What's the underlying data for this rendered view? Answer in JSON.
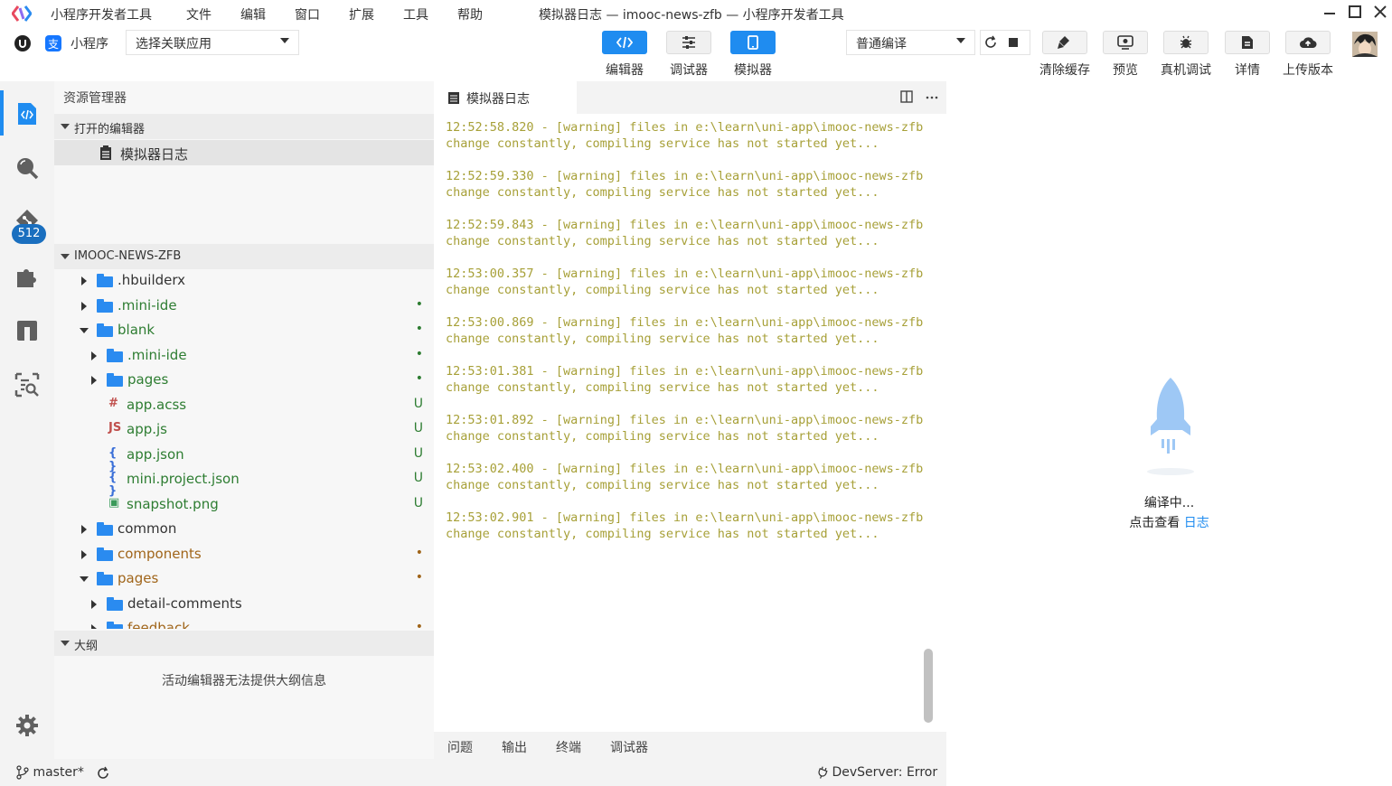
{
  "app": {
    "menu": [
      "小程序开发者工具",
      "文件",
      "编辑",
      "窗口",
      "扩展",
      "工具",
      "帮助"
    ],
    "window_title": "模拟器日志 — imooc-news-zfb — 小程序开发者工具"
  },
  "toolbar": {
    "mode_label": "小程序",
    "app_select": "选择关联应用",
    "view_buttons": [
      {
        "label": "编辑器",
        "icon": "code-icon",
        "active": true
      },
      {
        "label": "调试器",
        "icon": "sliders-icon",
        "active": false
      },
      {
        "label": "模拟器",
        "icon": "phone-icon",
        "active": true
      }
    ],
    "compile_select": "普通编译",
    "actions": [
      {
        "label": "清除缓存",
        "icon": "brush-icon"
      },
      {
        "label": "预览",
        "icon": "eye-icon"
      },
      {
        "label": "真机调试",
        "icon": "bug-icon"
      },
      {
        "label": "详情",
        "icon": "document-icon"
      },
      {
        "label": "上传版本",
        "icon": "cloud-upload-icon"
      }
    ]
  },
  "activity_bar": {
    "items": [
      "code-icon",
      "search-icon",
      "source-control-icon",
      "extensions-icon",
      "layout-icon",
      "inspect-icon"
    ],
    "badge": "512",
    "settings_icon": "gear-icon"
  },
  "sidebar": {
    "title": "资源管理器",
    "open_editors_header": "打开的编辑器",
    "open_editors": [
      "模拟器日志"
    ],
    "project_header": "IMOOC-NEWS-ZFB",
    "tree": [
      {
        "name": ".hbuilderx",
        "type": "folder",
        "depth": 0,
        "expanded": false,
        "status": "",
        "color": "#333333"
      },
      {
        "name": ".mini-ide",
        "type": "folder",
        "depth": 0,
        "expanded": false,
        "status": "•",
        "color": "#2e7d32"
      },
      {
        "name": "blank",
        "type": "folder",
        "depth": 0,
        "expanded": true,
        "status": "•",
        "color": "#2e7d32"
      },
      {
        "name": ".mini-ide",
        "type": "folder",
        "depth": 1,
        "expanded": false,
        "status": "•",
        "color": "#2e7d32"
      },
      {
        "name": "pages",
        "type": "folder",
        "depth": 1,
        "expanded": false,
        "status": "•",
        "color": "#2e7d32"
      },
      {
        "name": "app.acss",
        "type": "css",
        "depth": 1,
        "status": "U",
        "color": "#2e7d32"
      },
      {
        "name": "app.js",
        "type": "js",
        "depth": 1,
        "status": "U",
        "color": "#2e7d32"
      },
      {
        "name": "app.json",
        "type": "json",
        "depth": 1,
        "status": "U",
        "color": "#2e7d32"
      },
      {
        "name": "mini.project.json",
        "type": "json",
        "depth": 1,
        "status": "U",
        "color": "#2e7d32"
      },
      {
        "name": "snapshot.png",
        "type": "image",
        "depth": 1,
        "status": "U",
        "color": "#2e7d32"
      },
      {
        "name": "common",
        "type": "folder",
        "depth": 0,
        "expanded": false,
        "status": "",
        "color": "#333333"
      },
      {
        "name": "components",
        "type": "folder",
        "depth": 0,
        "expanded": false,
        "status": "•",
        "color": "#a0651a"
      },
      {
        "name": "pages",
        "type": "folder",
        "depth": 0,
        "expanded": true,
        "status": "•",
        "color": "#a0651a"
      },
      {
        "name": "detail-comments",
        "type": "folder",
        "depth": 1,
        "expanded": false,
        "status": "",
        "color": "#333333"
      },
      {
        "name": "feedback",
        "type": "folder",
        "depth": 1,
        "expanded": false,
        "status": "•",
        "color": "#a0651a"
      }
    ],
    "outline_header": "大纲",
    "outline_message": "活动编辑器无法提供大纲信息"
  },
  "editor": {
    "tab_title": "模拟器日志",
    "log_message": " - [warning] files in e:\\learn\\uni-app\\imooc-news-zfb change constantly, compiling service has not started yet...",
    "log_times": [
      "12:52:58.820",
      "12:52:59.330",
      "12:52:59.843",
      "12:53:00.357",
      "12:53:00.869",
      "12:53:01.381",
      "12:53:01.892",
      "12:53:02.400",
      "12:53:02.901"
    ],
    "panel_tabs": [
      "问题",
      "输出",
      "终端",
      "调试器"
    ]
  },
  "simulator": {
    "status_line1": "编译中...",
    "status_line2": "点击查看",
    "log_link": "日志",
    "accent": "#1f8cf0"
  },
  "statusbar": {
    "branch": "master*",
    "devserver": "DevServer: Error"
  }
}
